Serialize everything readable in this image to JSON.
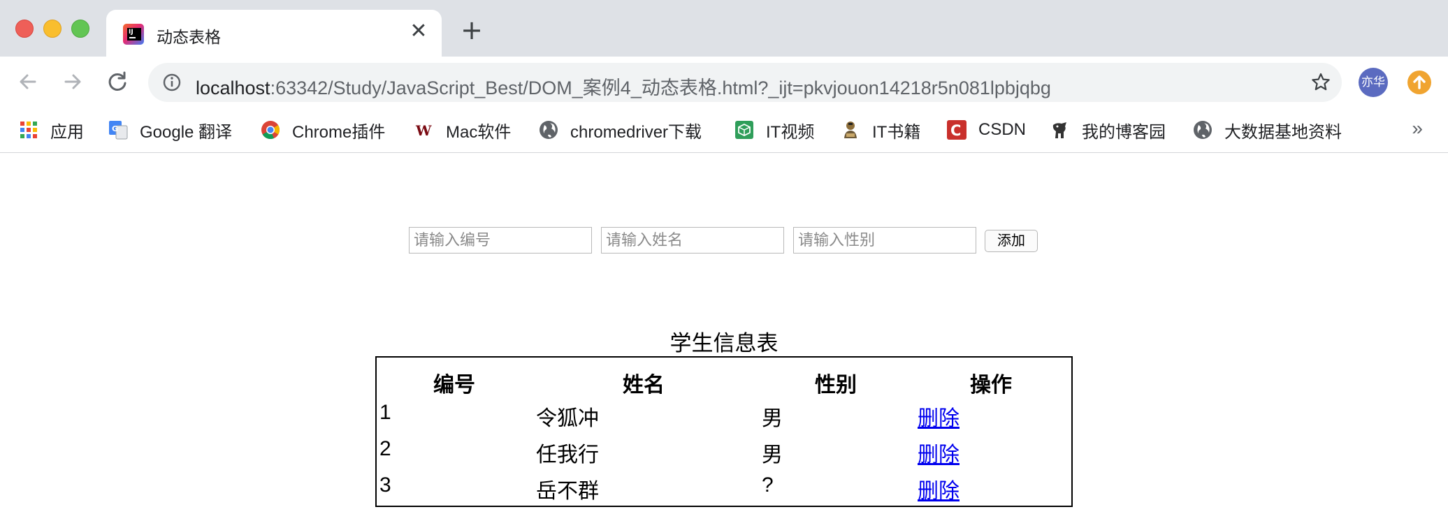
{
  "browser": {
    "tab_title": "动态表格",
    "tab_close": "✕",
    "new_tab": "+",
    "url_host": "localhost",
    "url_rest": ":63342/Study/JavaScript_Best/DOM_案例4_动态表格.html?_ijt=pkvjouon14218r5n081lpbjqbg",
    "profile_label": "亦华",
    "bookmarks": [
      {
        "label": "应用",
        "icon": "apps-grid-icon"
      },
      {
        "label": "Google 翻译",
        "icon": "google-translate-icon"
      },
      {
        "label": "Chrome插件",
        "icon": "chrome-icon"
      },
      {
        "label": "Mac软件",
        "icon": "mac-software-icon"
      },
      {
        "label": "chromedriver下载",
        "icon": "globe-icon"
      },
      {
        "label": "IT视频",
        "icon": "it-video-icon"
      },
      {
        "label": "IT书籍",
        "icon": "it-books-icon"
      },
      {
        "label": "CSDN",
        "icon": "csdn-icon"
      },
      {
        "label": "我的博客园",
        "icon": "blog-icon"
      },
      {
        "label": "大数据基地资料",
        "icon": "globe-icon"
      }
    ],
    "more": "»"
  },
  "form": {
    "id_placeholder": "请输入编号",
    "name_placeholder": "请输入姓名",
    "gender_placeholder": "请输入性别",
    "add_label": "添加"
  },
  "table": {
    "caption": "学生信息表",
    "headers": [
      "编号",
      "姓名",
      "性别",
      "操作"
    ],
    "rows": [
      {
        "id": "1",
        "name": "令狐冲",
        "gender": "男",
        "action": "删除"
      },
      {
        "id": "2",
        "name": "任我行",
        "gender": "男",
        "action": "删除"
      },
      {
        "id": "3",
        "name": "岳不群",
        "gender": "?",
        "action": "删除"
      }
    ]
  }
}
